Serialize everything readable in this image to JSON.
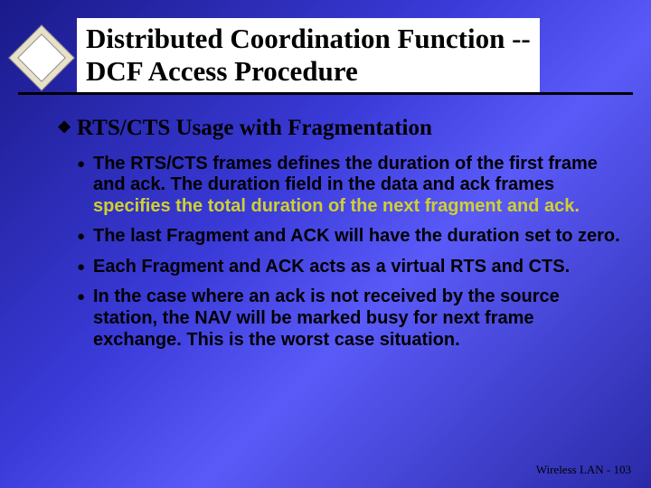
{
  "title_line1": "Distributed Coordination Function --",
  "title_line2": "DCF Access Procedure",
  "subheading": "RTS/CTS Usage with Fragmentation",
  "bullets": [
    {
      "pre": "The RTS/CTS frames defines the duration of the first frame and ack. The duration field in the data and ack frames ",
      "hl": "specifies the total duration of the next fragment and ack.",
      "post": ""
    },
    {
      "pre": "The last Fragment and ACK will have the duration set to zero.",
      "hl": "",
      "post": ""
    },
    {
      "pre": "Each Fragment and ACK acts as a virtual RTS and CTS.",
      "hl": "",
      "post": ""
    },
    {
      "pre": "In the case where an ack is not received by the source station, the NAV will be marked busy for next frame exchange. This is the worst case situation.",
      "hl": "",
      "post": ""
    }
  ],
  "footer": "Wireless LAN - 103"
}
